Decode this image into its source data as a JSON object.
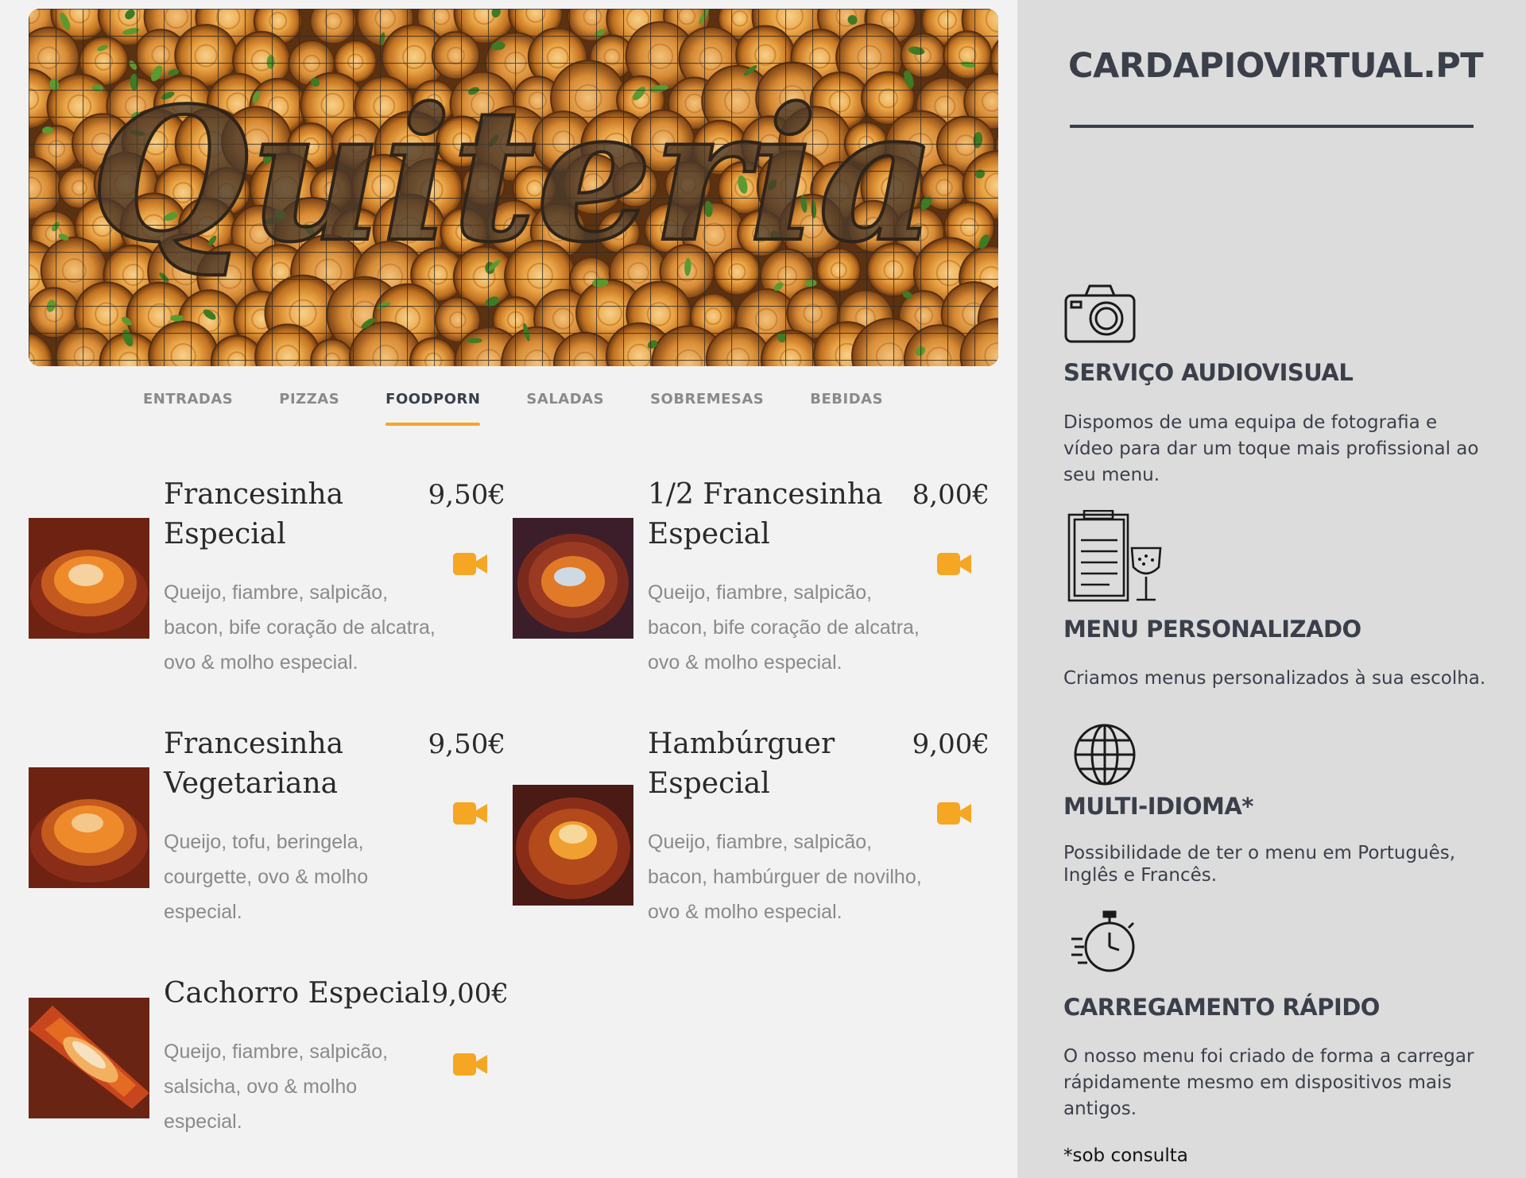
{
  "banner": {
    "sign_text": "Quiteria"
  },
  "tabs": [
    {
      "label": "ENTRADAS",
      "active": false
    },
    {
      "label": "PIZZAS",
      "active": false
    },
    {
      "label": "FOODPORN",
      "active": true
    },
    {
      "label": "SALADAS",
      "active": false
    },
    {
      "label": "SOBREMESAS",
      "active": false
    },
    {
      "label": "BEBIDAS",
      "active": false
    }
  ],
  "menu": {
    "items": [
      {
        "name": "Francesinha Especial",
        "price": "9,50€",
        "description": "Queijo, fiambre, salpicão, bacon, bife coração de alcatra, ovo & molho especial."
      },
      {
        "name": "1/2 Francesinha Especial",
        "price": "8,00€",
        "description": "Queijo, fiambre, salpicão, bacon, bife coração de alcatra, ovo & molho especial."
      },
      {
        "name": "Francesinha Vegetariana",
        "price": "9,50€",
        "description": "Queijo, tofu, beringela, courgette, ovo & molho especial."
      },
      {
        "name": "Hambúrguer Especial",
        "price": "9,00€",
        "description": "Queijo, fiambre, salpicão, bacon, hambúrguer de novilho, ovo & molho especial."
      },
      {
        "name": "Cachorro Especial",
        "price": "9,00€",
        "description": "Queijo, fiambre, salpicão, salsicha, ovo & molho especial."
      }
    ]
  },
  "sidebar": {
    "title": "CARDAPIOVIRTUAL.PT",
    "features": [
      {
        "icon": "camera-icon",
        "title": "SERVIÇO AUDIOVISUAL",
        "text": "Dispomos de uma equipa de fotografia e vídeo para dar um toque mais profissional ao seu menu."
      },
      {
        "icon": "clipboard-wine-icon",
        "title": "MENU PERSONALIZADO",
        "text": "Criamos menus personalizados à sua escolha."
      },
      {
        "icon": "globe-icon",
        "title": "MULTI-IDIOMA*",
        "text": "Possibilidade de ter o menu em Português, Inglês e Francês."
      },
      {
        "icon": "stopwatch-icon",
        "title": "CARREGAMENTO RÁPIDO",
        "text": "O nosso menu foi criado de forma a carregar rápidamente mesmo em dispositivos mais antigos."
      }
    ],
    "footnote": "*sob consulta"
  },
  "colors": {
    "accent": "#f5a623",
    "text_dark": "#3a3f4a",
    "text_muted": "#8a8a8a",
    "sidebar_bg": "#dcdcdc",
    "page_bg": "#f2f2f2"
  }
}
